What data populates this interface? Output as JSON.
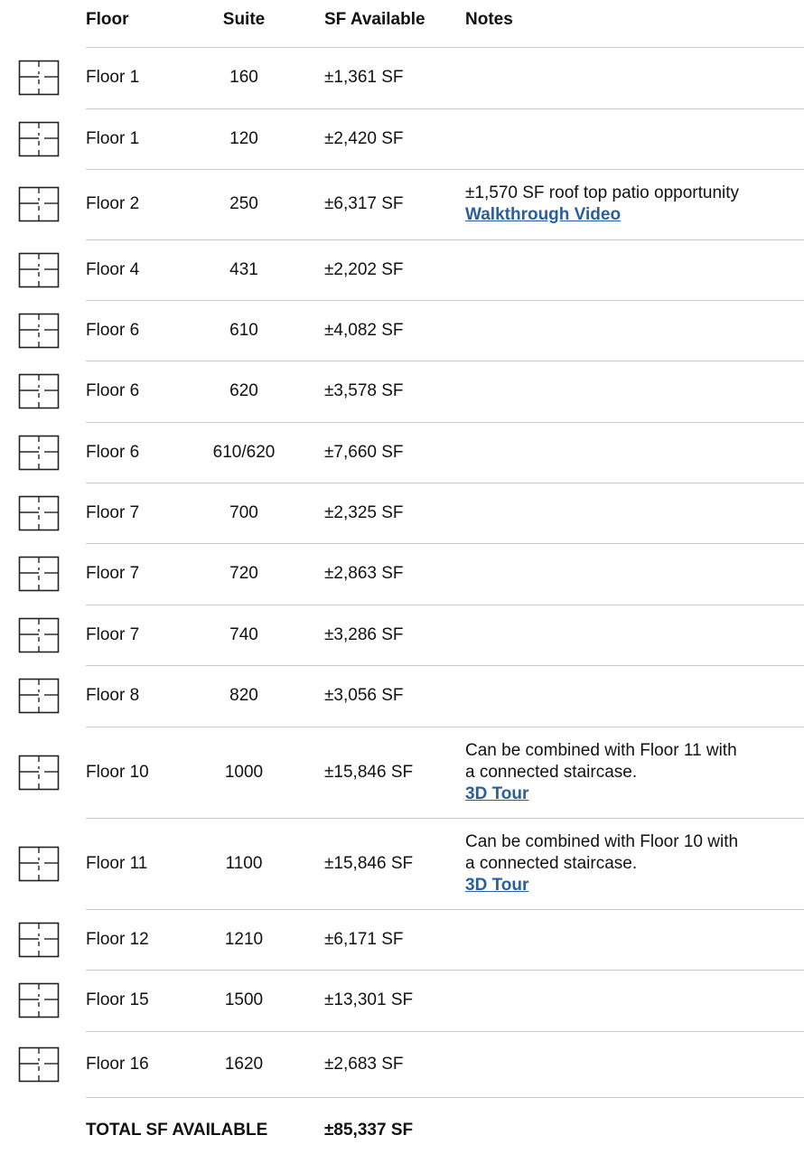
{
  "header": {
    "floor": "Floor",
    "suite": "Suite",
    "sf": "SF Available",
    "notes": "Notes"
  },
  "rows": [
    {
      "floor": "Floor 1",
      "suite": "160",
      "sf": "±1,361 SF"
    },
    {
      "floor": "Floor 1",
      "suite": "120",
      "sf": "±2,420 SF"
    },
    {
      "floor": "Floor 2",
      "suite": "250",
      "sf": "±6,317 SF",
      "notes": [
        "±1,570 SF roof top patio opportunity"
      ],
      "link": "Walkthrough Video"
    },
    {
      "floor": "Floor 4",
      "suite": "431",
      "sf": "±2,202 SF"
    },
    {
      "floor": "Floor 6",
      "suite": "610",
      "sf": "±4,082 SF"
    },
    {
      "floor": "Floor 6",
      "suite": "620",
      "sf": "±3,578 SF"
    },
    {
      "floor": "Floor 6",
      "suite": "610/620",
      "sf": "±7,660 SF"
    },
    {
      "floor": "Floor 7",
      "suite": "700",
      "sf": "±2,325 SF"
    },
    {
      "floor": "Floor 7",
      "suite": "720",
      "sf": "±2,863 SF"
    },
    {
      "floor": "Floor 7",
      "suite": "740",
      "sf": "±3,286 SF"
    },
    {
      "floor": "Floor 8",
      "suite": "820",
      "sf": "±3,056 SF"
    },
    {
      "floor": "Floor 10",
      "suite": "1000",
      "sf": "±15,846 SF",
      "notes": [
        "Can be combined with Floor 11 with",
        "a connected staircase."
      ],
      "link": "3D Tour"
    },
    {
      "floor": "Floor 11",
      "suite": "1100",
      "sf": "±15,846 SF",
      "notes": [
        "Can be combined with Floor 10 with",
        "a connected staircase."
      ],
      "link": "3D Tour"
    },
    {
      "floor": "Floor 12",
      "suite": "1210",
      "sf": "±6,171 SF"
    },
    {
      "floor": "Floor 15",
      "suite": "1500",
      "sf": "±13,301 SF"
    },
    {
      "floor": "Floor 16",
      "suite": "1620",
      "sf": "±2,683 SF"
    }
  ],
  "total": {
    "label": "TOTAL SF AVAILABLE",
    "value": "±85,337 SF"
  },
  "icons": {
    "floor_plan": "floor-plan-icon"
  },
  "colors": {
    "link": "#2a5f9e",
    "divider": "#c8c8c8",
    "icon_stroke": "#222222"
  }
}
